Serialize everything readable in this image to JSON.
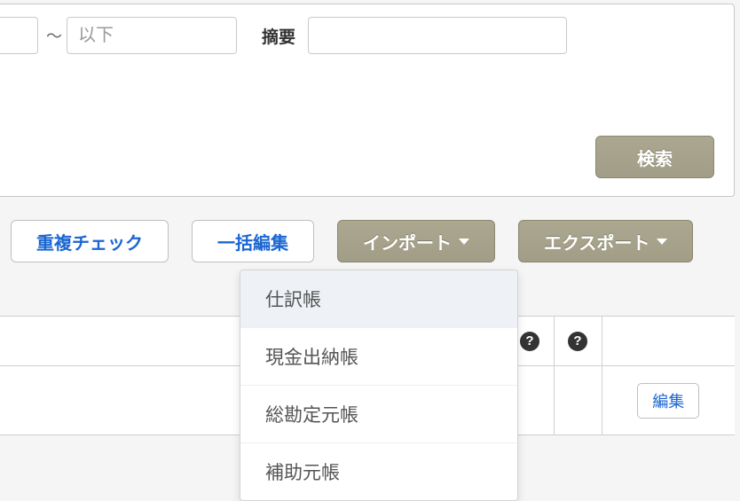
{
  "filter": {
    "range_separator": "〜",
    "lower_value": "",
    "upper_placeholder": "以下",
    "upper_value": "",
    "summary_label": "摘要",
    "summary_value": ""
  },
  "searchButton": "検索",
  "toolbar": {
    "dup_check": "重複チェック",
    "bulk_edit": "一括編集",
    "import": "インポート",
    "export": "エクスポート"
  },
  "importDropdown": {
    "items": [
      "仕訳帳",
      "現金出納帳",
      "総勘定元帳",
      "補助元帳"
    ]
  },
  "table": {
    "help_glyph": "?",
    "edit_button": "編集"
  }
}
